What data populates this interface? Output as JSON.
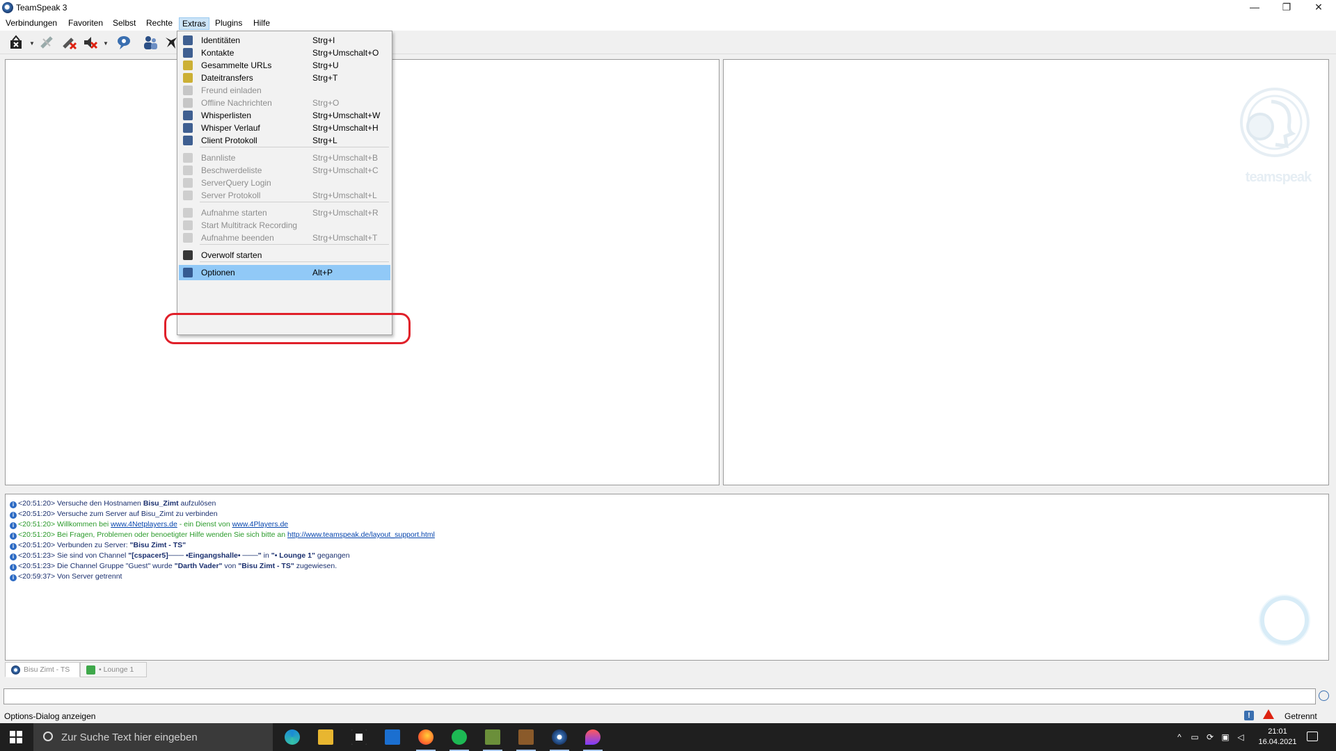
{
  "window": {
    "title": "TeamSpeak 3",
    "controls": {
      "minimize": "—",
      "restore": "❐",
      "close": "✕"
    }
  },
  "menubar": [
    "Verbindungen",
    "Favoriten",
    "Selbst",
    "Rechte",
    "Extras",
    "Plugins",
    "Hilfe"
  ],
  "active_menu": "Extras",
  "toolbar": {
    "icons": [
      "connect-icon",
      "disconnect-icon",
      "mute-microphone-icon",
      "mute-speakers-icon",
      "away-icon",
      "contacts-icon",
      "overwolf-icon"
    ]
  },
  "right_panel_logo": "teamspeak",
  "extras_menu": [
    {
      "label": "Identitäten",
      "shortcut": "Strg+I",
      "disabled": false
    },
    {
      "label": "Kontakte",
      "shortcut": "Strg+Umschalt+O",
      "disabled": false
    },
    {
      "label": "Gesammelte URLs",
      "shortcut": "Strg+U",
      "disabled": false
    },
    {
      "label": "Dateitransfers",
      "shortcut": "Strg+T",
      "disabled": false
    },
    {
      "label": "Freund einladen",
      "shortcut": "",
      "disabled": true
    },
    {
      "label": "Offline Nachrichten",
      "shortcut": "Strg+O",
      "disabled": true
    },
    {
      "label": "Whisperlisten",
      "shortcut": "Strg+Umschalt+W",
      "disabled": false
    },
    {
      "label": "Whisper Verlauf",
      "shortcut": "Strg+Umschalt+H",
      "disabled": false
    },
    {
      "label": "Client Protokoll",
      "shortcut": "Strg+L",
      "disabled": false
    },
    {
      "label": "Bannliste",
      "shortcut": "Strg+Umschalt+B",
      "disabled": true
    },
    {
      "label": "Beschwerdeliste",
      "shortcut": "Strg+Umschalt+C",
      "disabled": true
    },
    {
      "label": "ServerQuery Login",
      "shortcut": "",
      "disabled": true
    },
    {
      "label": "Server Protokoll",
      "shortcut": "Strg+Umschalt+L",
      "disabled": true
    },
    {
      "label": "Aufnahme starten",
      "shortcut": "Strg+Umschalt+R",
      "disabled": true
    },
    {
      "label": "Start Multitrack Recording",
      "shortcut": "",
      "disabled": true
    },
    {
      "label": "Aufnahme beenden",
      "shortcut": "Strg+Umschalt+T",
      "disabled": true
    },
    {
      "label": "Overwolf starten",
      "shortcut": "",
      "disabled": false
    },
    {
      "label": "Optionen",
      "shortcut": "Alt+P",
      "disabled": false
    }
  ],
  "log": [
    {
      "time": "<20:51:20>",
      "parts": [
        " Versuche den Hostnamen ",
        {
          "b": "Bisu_Zimt"
        },
        " aufzulösen"
      ]
    },
    {
      "time": "<20:51:20>",
      "parts": [
        " Versuche zum Server auf Bisu_Zimt zu verbinden"
      ]
    },
    {
      "time": "<20:51:20>",
      "green": true,
      "parts": [
        " Willkommen bei ",
        {
          "link": "www.4Netplayers.de"
        },
        " - ein Dienst von ",
        {
          "link": "www.4Players.de"
        }
      ]
    },
    {
      "time": "<20:51:20>",
      "green": true,
      "parts": [
        " Bei Fragen, Problemen oder benoetigter Hilfe wenden Sie sich bitte an ",
        {
          "link": "http://www.teamspeak.de/layout_support.html"
        }
      ]
    },
    {
      "time": "<20:51:20>",
      "parts": [
        " Verbunden zu Server: ",
        {
          "b": "\"Bisu Zimt - TS\""
        }
      ]
    },
    {
      "time": "<20:51:23>",
      "parts": [
        " Sie sind von Channel ",
        {
          "b": "\"[cspacer5]─── •Eingangshalle• ───\""
        },
        " in ",
        {
          "b": "\"• Lounge 1\""
        },
        " gegangen"
      ]
    },
    {
      "time": "<20:51:23>",
      "parts": [
        " Die Channel Gruppe \"Guest\" wurde ",
        {
          "b": "\"Darth Vader\""
        },
        " von ",
        {
          "b": "\"Bisu Zimt - TS\""
        },
        " zugewiesen."
      ]
    },
    {
      "time": "<20:59:37>",
      "parts": [
        " Von Server getrennt"
      ]
    }
  ],
  "tabs": [
    {
      "label": "Bisu Zimt - TS"
    },
    {
      "label": "• Lounge 1"
    }
  ],
  "chat_input": {
    "value": "",
    "placeholder": ""
  },
  "status": {
    "text": "Options-Dialog anzeigen",
    "connection": "Getrennt"
  },
  "taskbar": {
    "search_placeholder": "Zur Suche Text hier eingeben",
    "apps": [
      "edge-icon",
      "file-explorer-icon",
      "store-icon",
      "mail-icon",
      "firefox-icon",
      "spotify-icon",
      "minecraft-icon",
      "minecraft-launcher-icon",
      "teamspeak-icon",
      "paint-icon"
    ],
    "time": "21:01",
    "date": "16.04.2021"
  },
  "colors": {
    "highlight": "#91c9f7",
    "annotation_ring": "#e0202a",
    "log_green": "#2a9a2a",
    "log_blue": "#1a2f6e"
  }
}
